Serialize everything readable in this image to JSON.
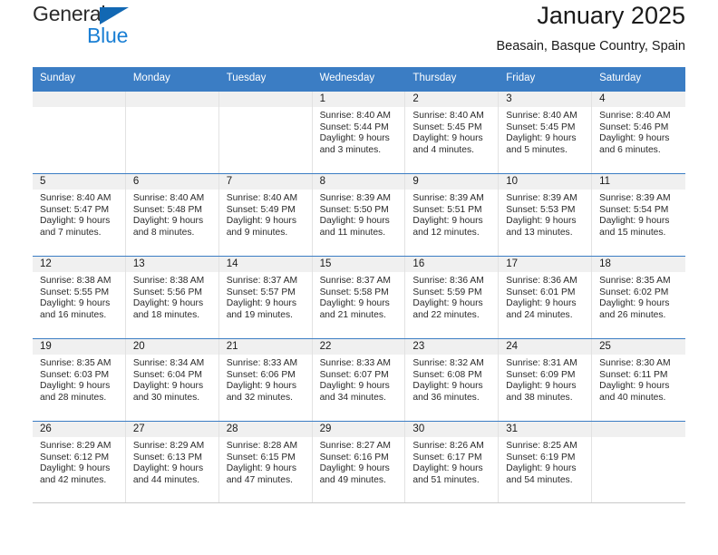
{
  "logo": {
    "word1": "General",
    "word2": "Blue",
    "triangle_color": "#1268b3",
    "blue_color": "#1a7fd4"
  },
  "header": {
    "title": "January 2025",
    "subtitle": "Beasain, Basque Country, Spain"
  },
  "theme": {
    "header_blue": "#3b7dc4",
    "daynum_strip": "#f0f0f0",
    "cell_border": "#e2e2e2"
  },
  "weekdays": [
    "Sunday",
    "Monday",
    "Tuesday",
    "Wednesday",
    "Thursday",
    "Friday",
    "Saturday"
  ],
  "weeks": [
    [
      {
        "day": "",
        "empty": true
      },
      {
        "day": "",
        "empty": true
      },
      {
        "day": "",
        "empty": true
      },
      {
        "day": "1",
        "sunrise": "Sunrise: 8:40 AM",
        "sunset": "Sunset: 5:44 PM",
        "daylight1": "Daylight: 9 hours",
        "daylight2": "and 3 minutes."
      },
      {
        "day": "2",
        "sunrise": "Sunrise: 8:40 AM",
        "sunset": "Sunset: 5:45 PM",
        "daylight1": "Daylight: 9 hours",
        "daylight2": "and 4 minutes."
      },
      {
        "day": "3",
        "sunrise": "Sunrise: 8:40 AM",
        "sunset": "Sunset: 5:45 PM",
        "daylight1": "Daylight: 9 hours",
        "daylight2": "and 5 minutes."
      },
      {
        "day": "4",
        "sunrise": "Sunrise: 8:40 AM",
        "sunset": "Sunset: 5:46 PM",
        "daylight1": "Daylight: 9 hours",
        "daylight2": "and 6 minutes."
      }
    ],
    [
      {
        "day": "5",
        "sunrise": "Sunrise: 8:40 AM",
        "sunset": "Sunset: 5:47 PM",
        "daylight1": "Daylight: 9 hours",
        "daylight2": "and 7 minutes."
      },
      {
        "day": "6",
        "sunrise": "Sunrise: 8:40 AM",
        "sunset": "Sunset: 5:48 PM",
        "daylight1": "Daylight: 9 hours",
        "daylight2": "and 8 minutes."
      },
      {
        "day": "7",
        "sunrise": "Sunrise: 8:40 AM",
        "sunset": "Sunset: 5:49 PM",
        "daylight1": "Daylight: 9 hours",
        "daylight2": "and 9 minutes."
      },
      {
        "day": "8",
        "sunrise": "Sunrise: 8:39 AM",
        "sunset": "Sunset: 5:50 PM",
        "daylight1": "Daylight: 9 hours",
        "daylight2": "and 11 minutes."
      },
      {
        "day": "9",
        "sunrise": "Sunrise: 8:39 AM",
        "sunset": "Sunset: 5:51 PM",
        "daylight1": "Daylight: 9 hours",
        "daylight2": "and 12 minutes."
      },
      {
        "day": "10",
        "sunrise": "Sunrise: 8:39 AM",
        "sunset": "Sunset: 5:53 PM",
        "daylight1": "Daylight: 9 hours",
        "daylight2": "and 13 minutes."
      },
      {
        "day": "11",
        "sunrise": "Sunrise: 8:39 AM",
        "sunset": "Sunset: 5:54 PM",
        "daylight1": "Daylight: 9 hours",
        "daylight2": "and 15 minutes."
      }
    ],
    [
      {
        "day": "12",
        "sunrise": "Sunrise: 8:38 AM",
        "sunset": "Sunset: 5:55 PM",
        "daylight1": "Daylight: 9 hours",
        "daylight2": "and 16 minutes."
      },
      {
        "day": "13",
        "sunrise": "Sunrise: 8:38 AM",
        "sunset": "Sunset: 5:56 PM",
        "daylight1": "Daylight: 9 hours",
        "daylight2": "and 18 minutes."
      },
      {
        "day": "14",
        "sunrise": "Sunrise: 8:37 AM",
        "sunset": "Sunset: 5:57 PM",
        "daylight1": "Daylight: 9 hours",
        "daylight2": "and 19 minutes."
      },
      {
        "day": "15",
        "sunrise": "Sunrise: 8:37 AM",
        "sunset": "Sunset: 5:58 PM",
        "daylight1": "Daylight: 9 hours",
        "daylight2": "and 21 minutes."
      },
      {
        "day": "16",
        "sunrise": "Sunrise: 8:36 AM",
        "sunset": "Sunset: 5:59 PM",
        "daylight1": "Daylight: 9 hours",
        "daylight2": "and 22 minutes."
      },
      {
        "day": "17",
        "sunrise": "Sunrise: 8:36 AM",
        "sunset": "Sunset: 6:01 PM",
        "daylight1": "Daylight: 9 hours",
        "daylight2": "and 24 minutes."
      },
      {
        "day": "18",
        "sunrise": "Sunrise: 8:35 AM",
        "sunset": "Sunset: 6:02 PM",
        "daylight1": "Daylight: 9 hours",
        "daylight2": "and 26 minutes."
      }
    ],
    [
      {
        "day": "19",
        "sunrise": "Sunrise: 8:35 AM",
        "sunset": "Sunset: 6:03 PM",
        "daylight1": "Daylight: 9 hours",
        "daylight2": "and 28 minutes."
      },
      {
        "day": "20",
        "sunrise": "Sunrise: 8:34 AM",
        "sunset": "Sunset: 6:04 PM",
        "daylight1": "Daylight: 9 hours",
        "daylight2": "and 30 minutes."
      },
      {
        "day": "21",
        "sunrise": "Sunrise: 8:33 AM",
        "sunset": "Sunset: 6:06 PM",
        "daylight1": "Daylight: 9 hours",
        "daylight2": "and 32 minutes."
      },
      {
        "day": "22",
        "sunrise": "Sunrise: 8:33 AM",
        "sunset": "Sunset: 6:07 PM",
        "daylight1": "Daylight: 9 hours",
        "daylight2": "and 34 minutes."
      },
      {
        "day": "23",
        "sunrise": "Sunrise: 8:32 AM",
        "sunset": "Sunset: 6:08 PM",
        "daylight1": "Daylight: 9 hours",
        "daylight2": "and 36 minutes."
      },
      {
        "day": "24",
        "sunrise": "Sunrise: 8:31 AM",
        "sunset": "Sunset: 6:09 PM",
        "daylight1": "Daylight: 9 hours",
        "daylight2": "and 38 minutes."
      },
      {
        "day": "25",
        "sunrise": "Sunrise: 8:30 AM",
        "sunset": "Sunset: 6:11 PM",
        "daylight1": "Daylight: 9 hours",
        "daylight2": "and 40 minutes."
      }
    ],
    [
      {
        "day": "26",
        "sunrise": "Sunrise: 8:29 AM",
        "sunset": "Sunset: 6:12 PM",
        "daylight1": "Daylight: 9 hours",
        "daylight2": "and 42 minutes."
      },
      {
        "day": "27",
        "sunrise": "Sunrise: 8:29 AM",
        "sunset": "Sunset: 6:13 PM",
        "daylight1": "Daylight: 9 hours",
        "daylight2": "and 44 minutes."
      },
      {
        "day": "28",
        "sunrise": "Sunrise: 8:28 AM",
        "sunset": "Sunset: 6:15 PM",
        "daylight1": "Daylight: 9 hours",
        "daylight2": "and 47 minutes."
      },
      {
        "day": "29",
        "sunrise": "Sunrise: 8:27 AM",
        "sunset": "Sunset: 6:16 PM",
        "daylight1": "Daylight: 9 hours",
        "daylight2": "and 49 minutes."
      },
      {
        "day": "30",
        "sunrise": "Sunrise: 8:26 AM",
        "sunset": "Sunset: 6:17 PM",
        "daylight1": "Daylight: 9 hours",
        "daylight2": "and 51 minutes."
      },
      {
        "day": "31",
        "sunrise": "Sunrise: 8:25 AM",
        "sunset": "Sunset: 6:19 PM",
        "daylight1": "Daylight: 9 hours",
        "daylight2": "and 54 minutes."
      },
      {
        "day": "",
        "empty": true
      }
    ]
  ]
}
